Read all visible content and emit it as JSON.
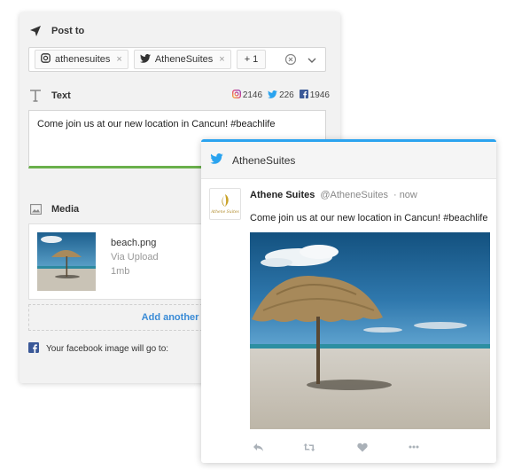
{
  "composer": {
    "post_to_label": "Post to",
    "accounts": [
      {
        "network": "instagram",
        "name": "athenesuites",
        "remove": "×"
      },
      {
        "network": "twitter",
        "name": "AtheneSuites",
        "remove": "×"
      }
    ],
    "more_count": "+ 1",
    "text_label": "Text",
    "counts": {
      "instagram": "2146",
      "twitter": "226",
      "facebook": "1946"
    },
    "message": "Come join us at our new location in Cancun! #beachlife",
    "media_label": "Media",
    "media": {
      "filename": "beach.png",
      "source": "Via Upload",
      "size": "1mb"
    },
    "add_another": "Add another im",
    "facebook_note": "Your facebook image will go to:"
  },
  "tweet_preview": {
    "account": "AtheneSuites",
    "display_name": "Athene Suites",
    "handle": "@AtheneSuites",
    "time": "· now",
    "avatar_text": "Athene Suites",
    "text": "Come join us at our new location in Cancun! #beachlife"
  },
  "colors": {
    "twitter_blue": "#2aa3ef",
    "facebook_blue": "#3b5998",
    "link_blue": "#3a8bd6",
    "progress_green": "#6ab04c"
  },
  "icons": [
    "send-icon",
    "text-icon",
    "image-icon",
    "instagram-icon",
    "twitter-icon",
    "facebook-icon",
    "reply-icon",
    "retweet-icon",
    "like-icon",
    "more-icon"
  ]
}
